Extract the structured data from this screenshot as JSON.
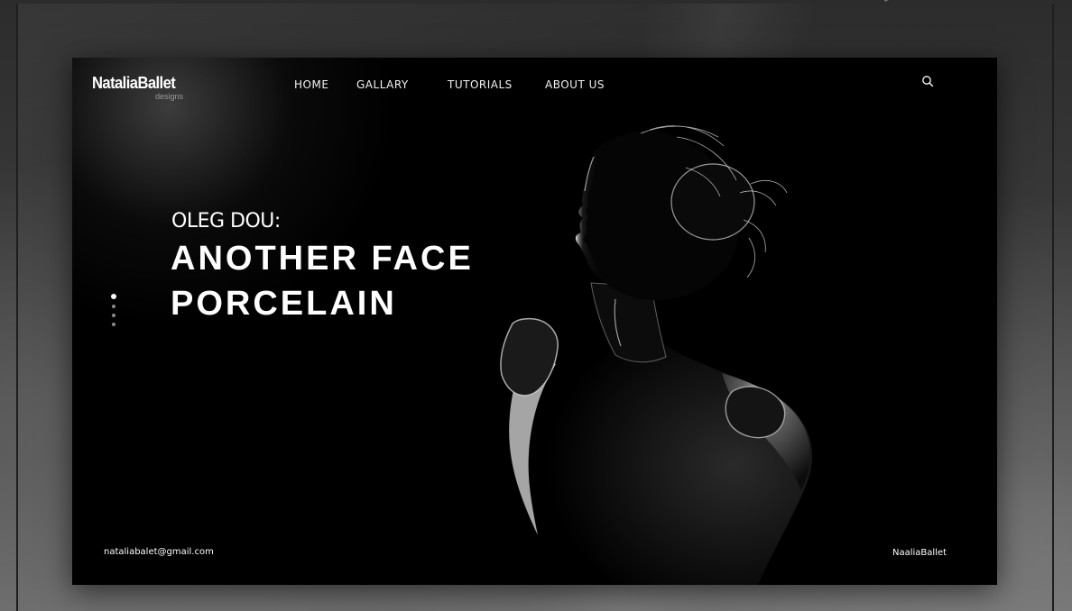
{
  "logo": {
    "main": "NataliaBallet",
    "sub": "designs"
  },
  "nav": {
    "items": [
      {
        "label": "HOME"
      },
      {
        "label": "GALLARY"
      },
      {
        "label": "TUTORIALS"
      },
      {
        "label": "ABOUT US"
      }
    ]
  },
  "search": {
    "icon": "search-icon"
  },
  "hero": {
    "kicker": "OLEG DOU:",
    "headline_line1": "ANOTHER FACE",
    "headline_line2": "PORCELAIN",
    "image": "silhouette-portrait"
  },
  "slider": {
    "count": 4,
    "active_index": 0
  },
  "footer": {
    "email": "nataliabalet@gmail.com",
    "brand": "NaaliaBallet"
  },
  "colors": {
    "background": "#000000",
    "text": "#ffffff",
    "inactive_dot": "#8a8a8a"
  }
}
